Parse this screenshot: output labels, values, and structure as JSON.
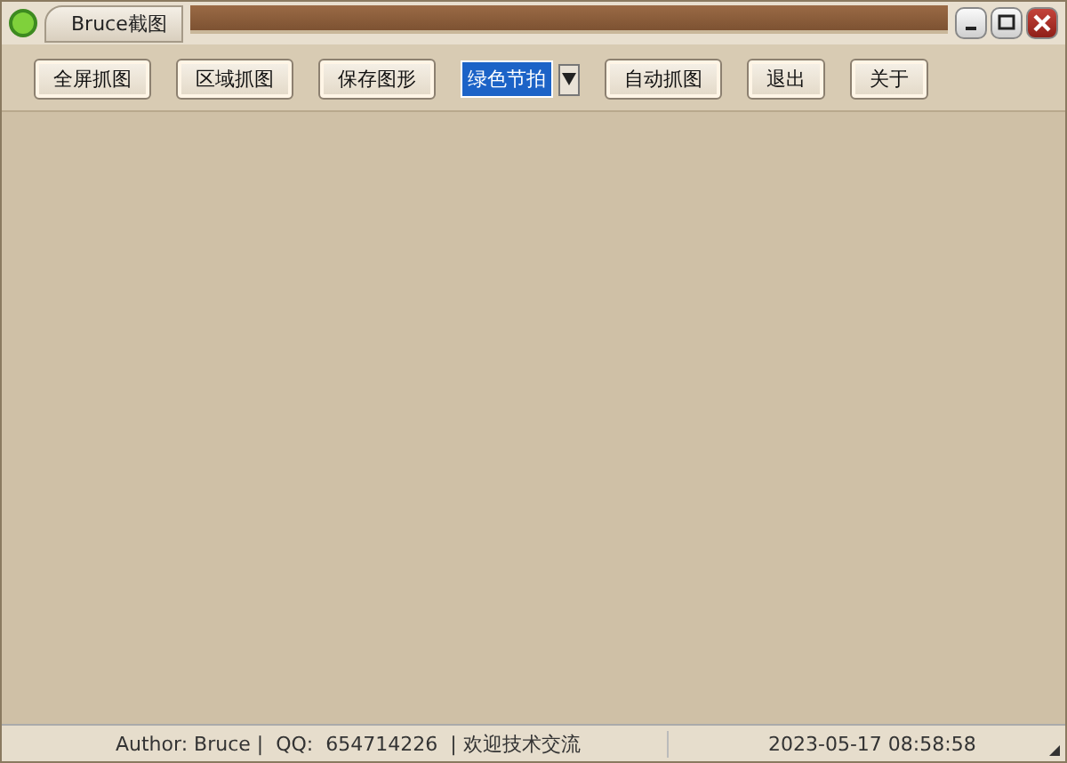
{
  "window": {
    "title": "Bruce截图"
  },
  "toolbar": {
    "buttons_left": [
      "全屏抓图",
      "区域抓图",
      "保存图形"
    ],
    "combo": {
      "value": "绿色节拍",
      "selected": true
    },
    "buttons_right": [
      "自动抓图",
      "退出",
      "关于"
    ]
  },
  "status_bar": {
    "info": "Author: Bruce |  QQ:  654714226  | 欢迎技术交流",
    "time": "2023-05-17 08:58:58"
  }
}
